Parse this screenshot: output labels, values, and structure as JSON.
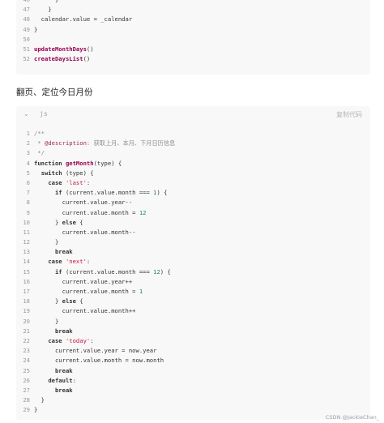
{
  "block1": {
    "lines": [
      {
        "n": "46",
        "text": "      }"
      },
      {
        "n": "47",
        "text": "    }"
      },
      {
        "n": "48",
        "text": "  calendar.value = _calendar"
      },
      {
        "n": "49",
        "text": "}"
      },
      {
        "n": "50",
        "text": ""
      },
      {
        "n": "51",
        "text": "updateMonthDays()"
      },
      {
        "n": "52",
        "text": "createDaysList()"
      }
    ]
  },
  "heading": "翻页、定位今日月份",
  "block2": {
    "lang": "js",
    "copy_label": "复制代码",
    "lines": [
      {
        "n": "1",
        "text": "/**"
      },
      {
        "n": "2",
        "text": " * @description: 获取上月、本月、下月日历信息"
      },
      {
        "n": "3",
        "text": " */"
      },
      {
        "n": "4",
        "text": "function getMonth(type) {"
      },
      {
        "n": "5",
        "text": "  switch (type) {"
      },
      {
        "n": "6",
        "text": "    case 'last':"
      },
      {
        "n": "7",
        "text": "      if (current.value.month === 1) {"
      },
      {
        "n": "8",
        "text": "        current.value.year--"
      },
      {
        "n": "9",
        "text": "        current.value.month = 12"
      },
      {
        "n": "10",
        "text": "      } else {"
      },
      {
        "n": "11",
        "text": "        current.value.month--"
      },
      {
        "n": "12",
        "text": "      }"
      },
      {
        "n": "13",
        "text": "      break"
      },
      {
        "n": "14",
        "text": "    case 'next':"
      },
      {
        "n": "15",
        "text": "      if (current.value.month === 12) {"
      },
      {
        "n": "16",
        "text": "        current.value.year++"
      },
      {
        "n": "17",
        "text": "        current.value.month = 1"
      },
      {
        "n": "18",
        "text": "      } else {"
      },
      {
        "n": "19",
        "text": "        current.value.month++"
      },
      {
        "n": "20",
        "text": "      }"
      },
      {
        "n": "21",
        "text": "      break"
      },
      {
        "n": "22",
        "text": "    case 'today':"
      },
      {
        "n": "23",
        "text": "      current.value.year = now.year"
      },
      {
        "n": "24",
        "text": "      current.value.month = now.month"
      },
      {
        "n": "25",
        "text": "      break"
      },
      {
        "n": "26",
        "text": "    default:"
      },
      {
        "n": "27",
        "text": "      break"
      },
      {
        "n": "28",
        "text": "  }"
      },
      {
        "n": "29",
        "text": "}"
      }
    ]
  },
  "watermark": "CSDN @JackieChan_"
}
